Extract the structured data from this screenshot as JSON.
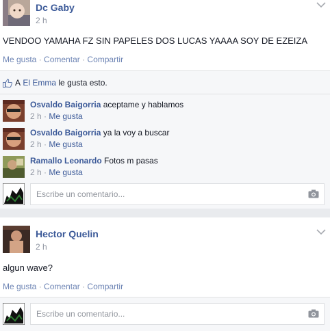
{
  "posts": [
    {
      "author": "Dc Gaby",
      "time": "2 h",
      "text": "VENDOO YAMAHA FZ SIN PAPELES DOS LUCAS YAAAA SOY DE EZEIZA",
      "actions": {
        "like": "Me gusta",
        "comment": "Comentar",
        "share": "Compartir",
        "sep": "·"
      },
      "likes": {
        "prefix": "A",
        "user": "El Emma",
        "suffix": "le gusta esto."
      },
      "comments": [
        {
          "author": "Osvaldo Baigorria",
          "text": "aceptame y hablamos",
          "time": "2 h",
          "like": "Me gusta"
        },
        {
          "author": "Osvaldo Baigorria",
          "text": "ya la voy a buscar",
          "time": "2 h",
          "like": "Me gusta"
        },
        {
          "author": "Ramallo Leonardo",
          "text": "Fotos m pasas",
          "time": "2 h",
          "like": "Me gusta"
        }
      ],
      "comment_placeholder": "Escribe un comentario..."
    },
    {
      "author": "Hector Quelin",
      "time": "2 h",
      "text": "algun wave?",
      "actions": {
        "like": "Me gusta",
        "comment": "Comentar",
        "share": "Compartir",
        "sep": "·"
      },
      "comment_placeholder": "Escribe un comentario..."
    }
  ],
  "colors": {
    "link": "#3b5998",
    "meta": "#9197a3",
    "panel": "#f6f7f9"
  },
  "icons": {
    "like": "thumbs-up-icon",
    "camera": "camera-icon",
    "menu": "chevron-down-icon"
  }
}
